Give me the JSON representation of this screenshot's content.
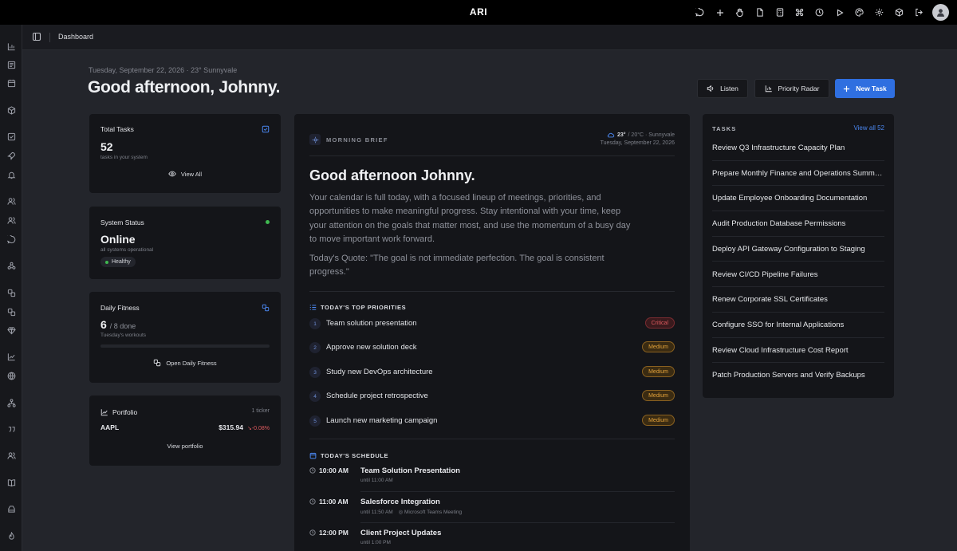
{
  "app": {
    "title": "ARI"
  },
  "topbar": {
    "icons": [
      "chat-icon",
      "plus-icon",
      "hand-icon",
      "file-icon",
      "calculator-icon",
      "command-icon",
      "clock-icon",
      "play-icon",
      "palette-icon",
      "gear-icon",
      "cube-icon",
      "logout-icon",
      "user-avatar-icon"
    ]
  },
  "breadcrumb": {
    "current": "Dashboard"
  },
  "header": {
    "date_line": "Tuesday, September 22, 2026 · 23° Sunnyvale",
    "greeting": "Good afternoon, Johnny.",
    "listen_label": "Listen",
    "priority_radar_label": "Priority Radar",
    "new_task_label": "New Task"
  },
  "cards": {
    "total_tasks": {
      "title": "Total Tasks",
      "value": "52",
      "subtitle": "tasks in your system",
      "link": "View All"
    },
    "system_status": {
      "title": "System Status",
      "value": "Online",
      "subtitle": "all systems operational",
      "badge": "Healthy",
      "status_color": "#3fb950"
    },
    "daily_fitness": {
      "title": "Daily Fitness",
      "value": "6",
      "suffix": "/ 8 done",
      "subtitle": "Tuesday's workouts",
      "progress": 0,
      "link": "Open Daily Fitness"
    },
    "portfolio": {
      "title": "Portfolio",
      "meta": "1 ticker",
      "ticker": "AAPL",
      "price": "$315.94",
      "change": "-0.08%",
      "link": "View portfolio"
    }
  },
  "brief": {
    "label": "MORNING BRIEF",
    "weather": "23°",
    "weather_detail": "/ 20°C · Sunnyvale",
    "date": "Tuesday, September 22, 2026",
    "greeting": "Good afternoon Johnny.",
    "summary": "Your calendar is full today, with a focused lineup of meetings, priorities, and opportunities to make meaningful progress. Stay intentional with your time, keep your attention on the goals that matter most, and use the momentum of a busy day to move important work forward.",
    "quote": "Today's Quote: \"The goal is not immediate perfection. The goal is consistent progress.\"",
    "priorities_heading": "TODAY'S TOP PRIORITIES",
    "priorities": [
      {
        "num": "1",
        "title": "Team solution presentation",
        "level": "Critical"
      },
      {
        "num": "2",
        "title": "Approve new solution deck",
        "level": "Medium"
      },
      {
        "num": "3",
        "title": "Study new DevOps architecture",
        "level": "Medium"
      },
      {
        "num": "4",
        "title": "Schedule project retrospective",
        "level": "Medium"
      },
      {
        "num": "5",
        "title": "Launch new marketing campaign",
        "level": "Medium"
      }
    ],
    "schedule_heading": "TODAY'S SCHEDULE",
    "schedule": [
      {
        "time": "10:00 AM",
        "title": "Team Solution Presentation",
        "until": "until 11:00 AM",
        "location": ""
      },
      {
        "time": "11:00 AM",
        "title": "Salesforce Integration",
        "until": "until 11:50 AM",
        "location": "Microsoft Teams Meeting"
      },
      {
        "time": "12:00 PM",
        "title": "Client Project Updates",
        "until": "until 1:00 PM",
        "location": ""
      }
    ]
  },
  "tasks": {
    "heading": "TASKS",
    "view_all": "View all 52",
    "items": [
      "Review Q3 Infrastructure Capacity Plan",
      "Prepare Monthly Finance and Operations Summary",
      "Update Employee Onboarding Documentation",
      "Audit Production Database Permissions",
      "Deploy API Gateway Configuration to Staging",
      "Review CI/CD Pipeline Failures",
      "Renew Corporate SSL Certificates",
      "Configure SSO for Internal Applications",
      "Review Cloud Infrastructure Cost Report",
      "Patch Production Servers and Verify Backups"
    ]
  },
  "colors": {
    "accent": "#2f6fe0",
    "critical": "#e05a5f",
    "medium": "#e2a13a",
    "negative": "#e05a5f"
  }
}
